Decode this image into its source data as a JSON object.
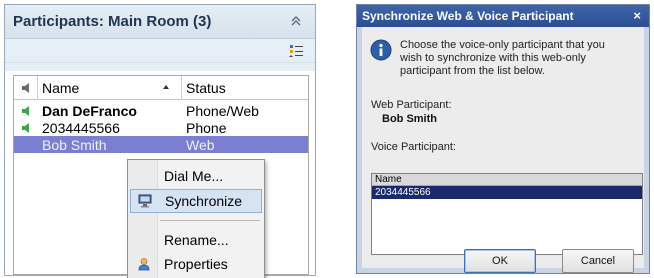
{
  "participants_panel": {
    "title": "Participants: Main Room (3)",
    "columns": {
      "name": "Name",
      "status": "Status"
    },
    "rows": [
      {
        "name": "Dan DeFranco",
        "status": "Phone/Web",
        "speaker": true,
        "bold": true,
        "selected": false
      },
      {
        "name": "2034445566",
        "status": "Phone",
        "speaker": true,
        "bold": false,
        "selected": false
      },
      {
        "name": "Bob Smith",
        "status": "Web",
        "speaker": false,
        "bold": false,
        "selected": true
      }
    ]
  },
  "context_menu": {
    "items": {
      "dial_me": "Dial Me...",
      "synchronize": "Synchronize",
      "rename": "Rename...",
      "properties": "Properties"
    }
  },
  "sync_dialog": {
    "title": "Synchronize Web & Voice Participant",
    "close_glyph": "×",
    "message": "Choose the voice-only participant that you wish to synchronize with this web-only participant from the list below.",
    "web_participant_label": "Web Participant:",
    "web_participant_value": "Bob Smith",
    "voice_participant_label": "Voice Participant:",
    "list_header": "Name",
    "list_items": [
      "2034445566"
    ],
    "ok_label": "OK",
    "cancel_label": "Cancel"
  },
  "colors": {
    "selected_row": "#7b7fd0",
    "dialog_title": "#2d4f92",
    "list_selection": "#1a2a6c",
    "speaker_green": "#3fa64a"
  }
}
